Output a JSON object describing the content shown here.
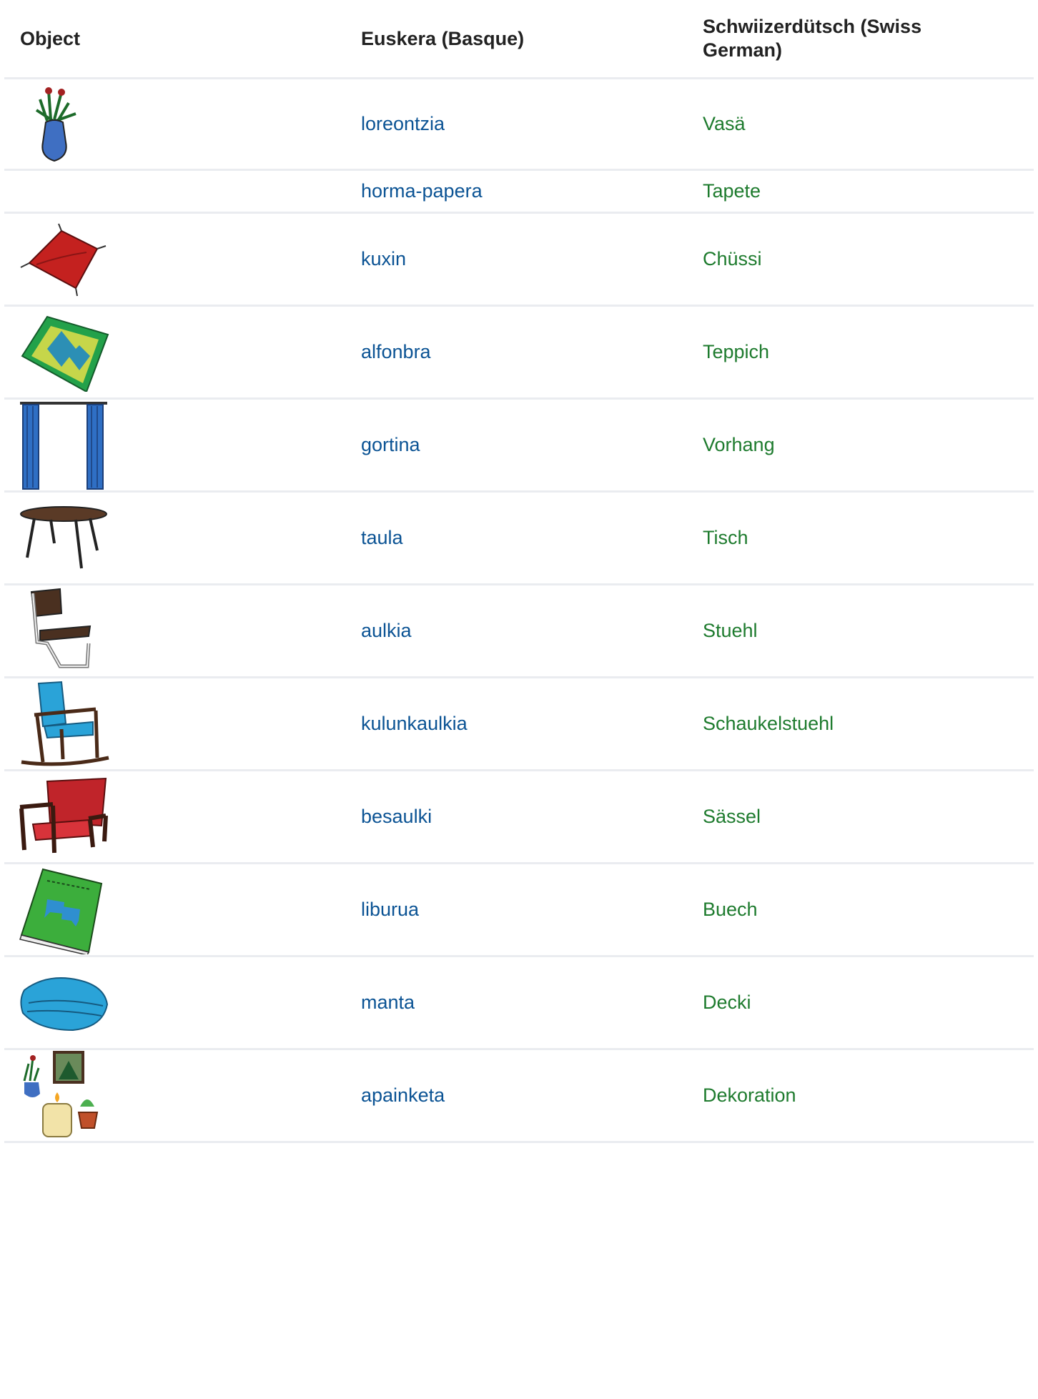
{
  "headers": {
    "object": "Object",
    "basque": "Euskera (Basque)",
    "swiss": "Schwiizerdütsch (Swiss German)"
  },
  "rows": [
    {
      "icon": "vase-with-flowers-icon",
      "basque": "loreontzia",
      "swiss": "Vasä"
    },
    {
      "icon": "",
      "basque": "horma-papera",
      "swiss": "Tapete"
    },
    {
      "icon": "red-cushion-icon",
      "basque": "kuxin",
      "swiss": "Chüssi"
    },
    {
      "icon": "green-rug-icon",
      "basque": "alfonbra",
      "swiss": "Teppich"
    },
    {
      "icon": "blue-curtain-icon",
      "basque": "gortina",
      "swiss": "Vorhang"
    },
    {
      "icon": "round-table-icon",
      "basque": "taula",
      "swiss": "Tisch"
    },
    {
      "icon": "cantilever-chair-icon",
      "basque": "aulkia",
      "swiss": "Stuehl"
    },
    {
      "icon": "rocking-chair-icon",
      "basque": "kulunkaulkia",
      "swiss": "Schaukelstuehl"
    },
    {
      "icon": "red-armchair-icon",
      "basque": "besaulki",
      "swiss": "Sässel"
    },
    {
      "icon": "green-book-icon",
      "basque": "liburua",
      "swiss": "Buech"
    },
    {
      "icon": "folded-blanket-icon",
      "basque": "manta",
      "swiss": "Decki"
    },
    {
      "icon": "decoration-icon",
      "basque": "apainketa",
      "swiss": "Dekoration"
    }
  ],
  "colors": {
    "basque_link": "#0b5394",
    "swiss_link": "#1e7b2e",
    "row_border": "#eaecf0"
  }
}
